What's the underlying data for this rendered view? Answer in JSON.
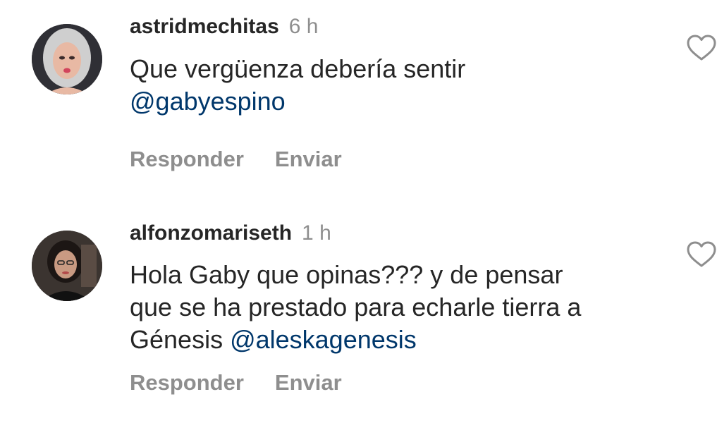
{
  "comments": [
    {
      "username": "astridmechitas",
      "time": "6 h",
      "text_line_1": "Que vergüenza debería sentir",
      "text_line_2_mention": "@gabyespino",
      "reply_label": "Responder",
      "send_label": "Enviar",
      "like_icon": "heart-outline-icon"
    },
    {
      "username": "alfonzomariseth",
      "time": "1 h",
      "text_line_1": "Hola Gaby que opinas??? y de pensar",
      "text_line_2": "que se ha prestado para echarle tierra a",
      "text_line_3": "Génesis ",
      "text_line_3_mention": "@aleskagenesis",
      "reply_label": "Responder",
      "send_label": "Enviar",
      "like_icon": "heart-outline-icon"
    }
  ],
  "colors": {
    "text": "#262626",
    "secondary": "#8e8e8e",
    "mention": "#00376b",
    "background": "#ffffff"
  }
}
